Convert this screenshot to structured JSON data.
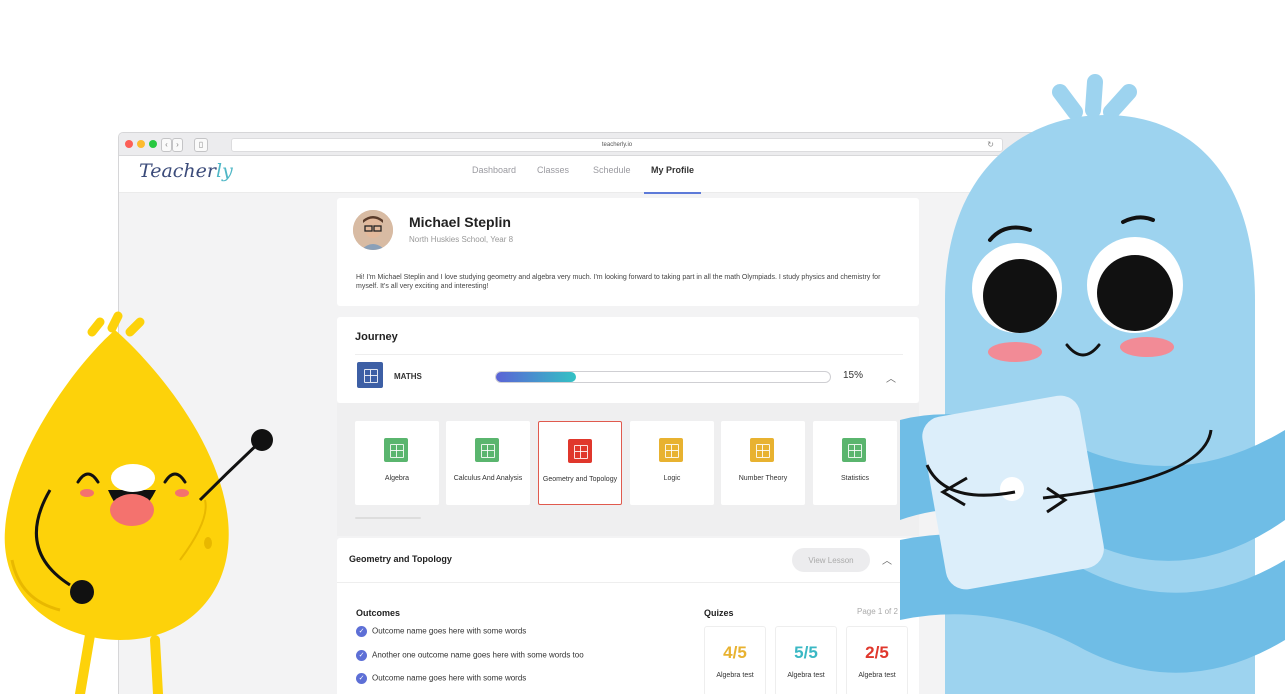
{
  "browser": {
    "url": "teacherly.io",
    "back": "‹",
    "forward": "›"
  },
  "app": {
    "logo_a": "Teacher",
    "logo_b": "ly",
    "nav": [
      "Dashboard",
      "Classes",
      "Schedule",
      "My Profile"
    ],
    "active_nav": "My Profile"
  },
  "profile": {
    "name": "Michael Steplin",
    "school": "North Huskies School, Year 8",
    "bio": "Hi! I'm Michael Steplin and I love studying geometry and algebra very much. I'm looking forward to taking part in all the math Olympiads. I study physics and chemistry for myself. It's all very exciting and interesting!"
  },
  "journey": {
    "title": "Journey",
    "subject": "MATHS",
    "progress": 0.15,
    "progress_label": "15%",
    "subjects": [
      {
        "label": "Algebra",
        "color": "#5ab56e"
      },
      {
        "label": "Calculus And Analysis",
        "color": "#5ab56e"
      },
      {
        "label": "Geometry and Topology",
        "color": "#e0372c",
        "selected": true
      },
      {
        "label": "Logic",
        "color": "#e8b230"
      },
      {
        "label": "Number Theory",
        "color": "#e8b230"
      },
      {
        "label": "Statistics",
        "color": "#5ab56e"
      }
    ]
  },
  "lesson": {
    "title": "Geometry and Topology",
    "view_button": "View Lesson",
    "outcomes_title": "Outcomes",
    "outcomes": [
      "Outcome name goes here with some words",
      "Another one outcome name goes here with some words too",
      "Outcome name goes here with some words"
    ],
    "quizzes_title": "Quizes",
    "pages": "Page 1 of 2",
    "quizzes": [
      {
        "score": "4/5",
        "label": "Algebra test",
        "color": "#e8b230"
      },
      {
        "score": "5/5",
        "label": "Algebra test",
        "color": "#3bb8c4"
      },
      {
        "score": "2/5",
        "label": "Algebra test",
        "color": "#e0372c"
      }
    ]
  },
  "colors": {
    "brand_blue": "#3b4b7a",
    "accent_teal": "#4fb7c6",
    "mascot_yellow": "#fdd20a",
    "mascot_blue": "#9dd3ef"
  }
}
